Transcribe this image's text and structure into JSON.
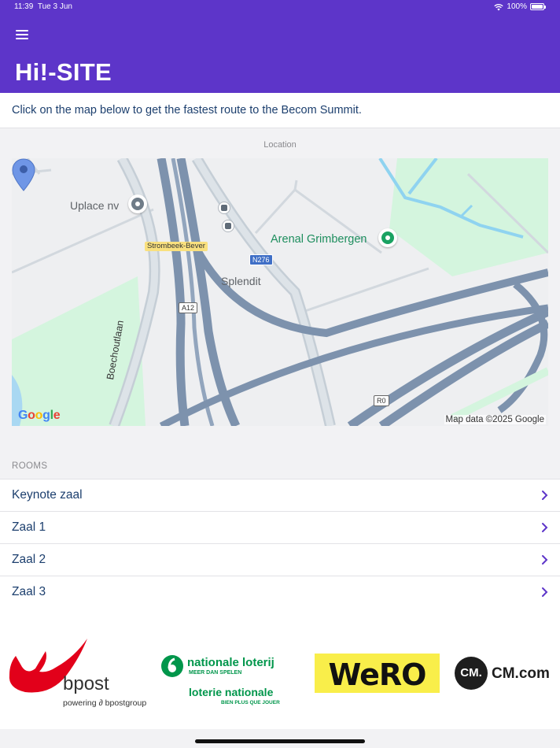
{
  "status_bar": {
    "time": "11:39",
    "date": "Tue 3 Jun",
    "battery": "100%"
  },
  "header": {
    "title": "Hi!-SITE",
    "menu_icon": "hamburger-icon"
  },
  "intro": {
    "text": "Click on the map below to get the fastest route to the Becom Summit."
  },
  "map": {
    "label": "Location",
    "places": [
      "Uplace nv",
      "Arenal Grimbergen",
      "Splendit",
      "Boechoutlaan"
    ],
    "area_label": "Strombeek-Bever",
    "road_signs": [
      "N276",
      "A12",
      "R0"
    ],
    "provider": "Google",
    "attribution": "Map data ©2025 Google"
  },
  "rooms": {
    "label": "ROOMS",
    "items": [
      {
        "name": "Keynote zaal"
      },
      {
        "name": "Zaal 1"
      },
      {
        "name": "Zaal 2"
      },
      {
        "name": "Zaal 3"
      }
    ]
  },
  "sponsors": {
    "bpost": {
      "name": "bpost",
      "tagline": "powering",
      "group": "bpostgroup"
    },
    "loterij": {
      "line1": "nationale loterij",
      "line1_sub": "MEER DAN SPELEN",
      "line2": "loterie nationale",
      "line2_sub": "BIEN PLUS QUE JOUER"
    },
    "wero": {
      "name": "WeRO"
    },
    "cm": {
      "badge": "CM.",
      "name": "CM.com"
    }
  },
  "colors": {
    "header": "#5d35c9",
    "text_blue": "#1c3f6e",
    "chevron": "#5d35c9"
  }
}
